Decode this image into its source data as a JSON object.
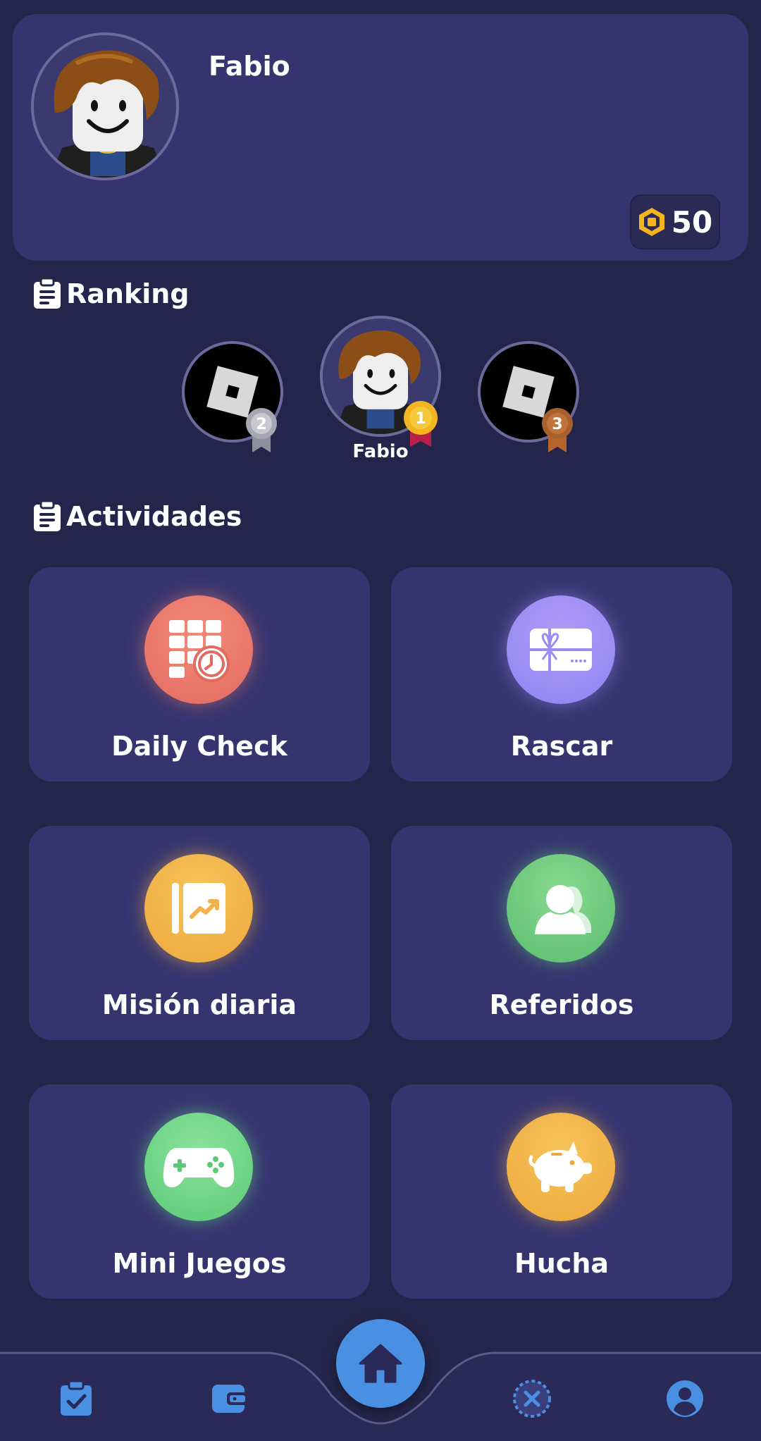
{
  "profile": {
    "name": "Fabio",
    "coins": "50"
  },
  "ranking": {
    "title": "Ranking",
    "podium": [
      {
        "place": "2",
        "name": "",
        "avatar": "roblox-logo"
      },
      {
        "place": "1",
        "name": "Fabio",
        "avatar": "user-avatar"
      },
      {
        "place": "3",
        "name": "",
        "avatar": "roblox-logo"
      }
    ]
  },
  "activities": {
    "title": "Actividades",
    "items": [
      {
        "label": "Daily Check",
        "icon": "calendar-clock-icon",
        "color": "#ec7a6f"
      },
      {
        "label": "Rascar",
        "icon": "gift-card-icon",
        "color": "#9b8cf4"
      },
      {
        "label": "Misión diaria",
        "icon": "mission-chart-icon",
        "color": "#f2b24a"
      },
      {
        "label": "Referidos",
        "icon": "referrals-icon",
        "color": "#6bcc7c"
      },
      {
        "label": "Mini Juegos",
        "icon": "gamepad-icon",
        "color": "#6fd48a"
      },
      {
        "label": "Hucha",
        "icon": "piggy-bank-icon",
        "color": "#f2b24a"
      }
    ]
  },
  "nav": {
    "items": [
      "tasks-icon",
      "wallet-icon",
      "home-icon",
      "cancel-icon",
      "profile-icon"
    ],
    "accent": "#4a90e2"
  }
}
